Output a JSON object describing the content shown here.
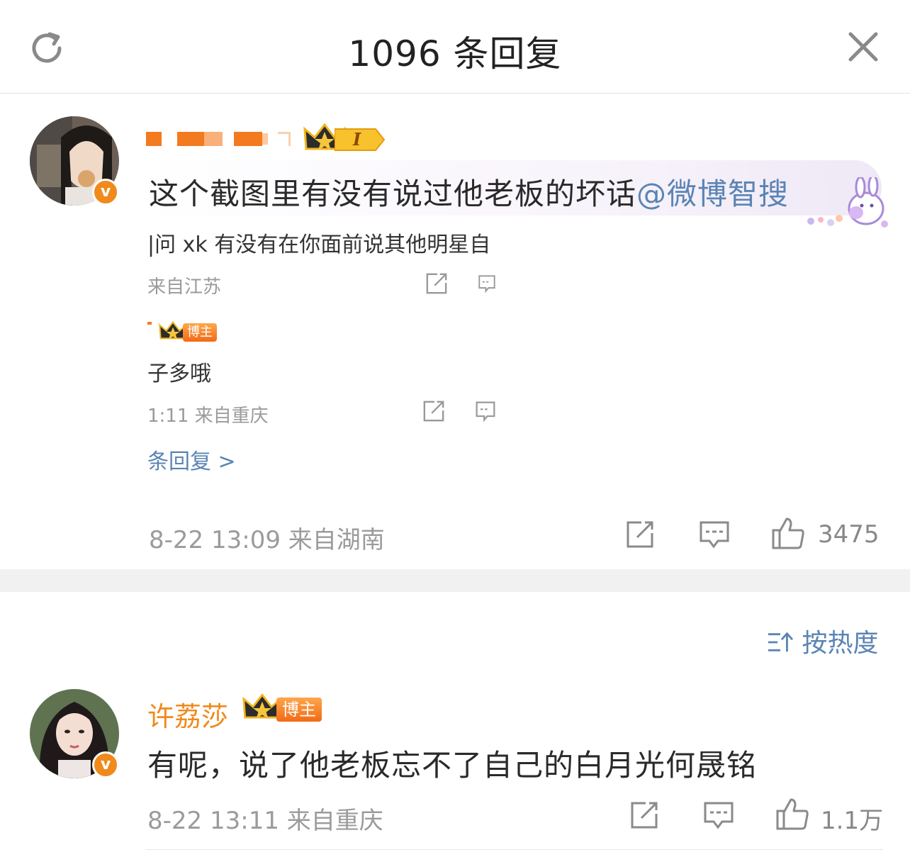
{
  "header": {
    "title": "1096 条回复",
    "refresh_icon": "refresh-icon",
    "close_icon": "close-icon"
  },
  "main_comment": {
    "level_badge": "I",
    "text": "这个截图里有没有说过他老板的坏话",
    "mention": "@微博智搜",
    "screenshot": {
      "line1": "|问 xk 有没有在你面前说其他明星自",
      "line1_meta": "来自江苏",
      "badge": "博主",
      "line2": "子多哦",
      "line2_meta": "1:11  来自重庆",
      "more": "条回复 >"
    },
    "meta": "8-22 13:09  来自湖南",
    "like_count": "3475"
  },
  "sort": {
    "label": "按热度"
  },
  "reply": {
    "author": "许荔莎",
    "badge": "博主",
    "text": "有呢，说了他老板忘不了自己的白月光何晟铭",
    "meta": "8-22 13:11  来自重庆",
    "like_count": "1.1万"
  },
  "colors": {
    "accent_blue": "#5b84b4",
    "orange": "#f08a1c",
    "meta_gray": "#9b9b9b"
  }
}
